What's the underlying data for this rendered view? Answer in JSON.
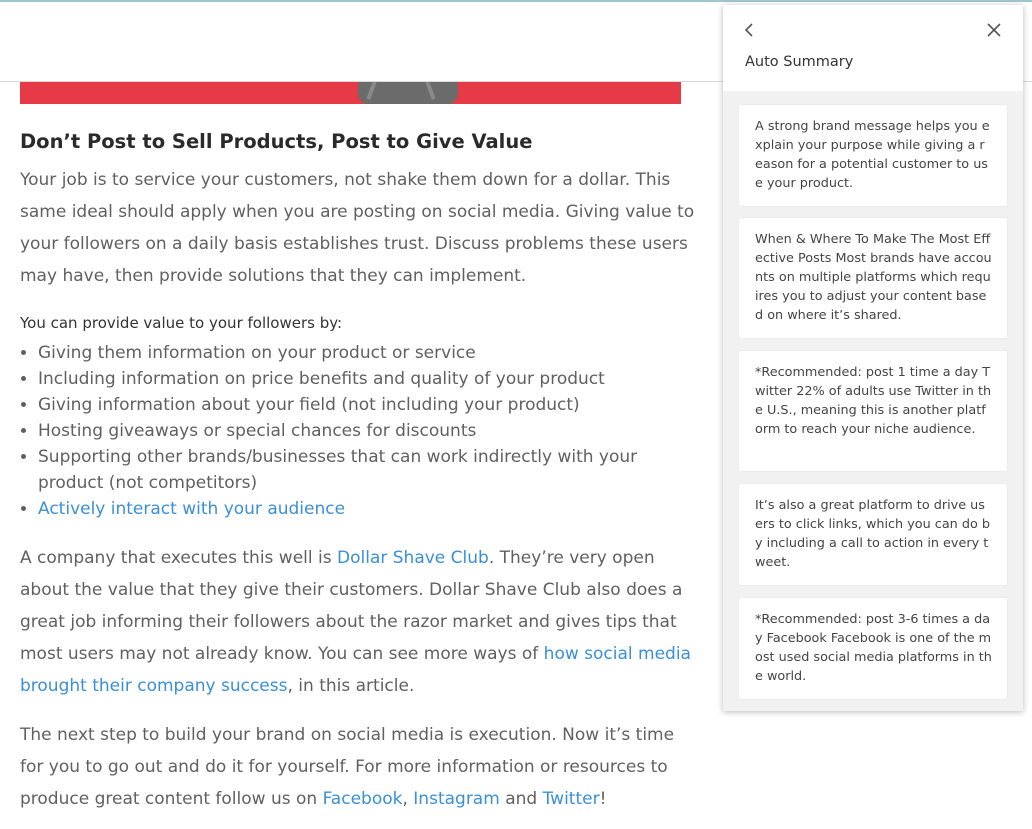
{
  "article": {
    "heading": "Don’t Post to Sell Products, Post to Give Value",
    "paragraph1": "Your job is to service your customers, not shake them down for a dollar. This same ideal should apply when you are posting on social media. Giving value to your followers on a daily basis establishes trust. Discuss problems these users may have, then provide solutions that they can implement.",
    "intro": "You can provide value to your followers by:",
    "bullets": [
      "Giving them information on your product or service",
      "Including information on price benefits and quality of your product",
      "Giving information about your field (not including your product)",
      "Hosting giveaways or special chances for discounts",
      "Supporting other brands/businesses that can work indirectly with your product (not competitors)"
    ],
    "bullet_link": "Actively interact with your audience",
    "paragraph2": {
      "before": "A company that executes this well is ",
      "link1": "Dollar Shave Club",
      "middle": ". They’re very open about the value that they give their customers. Dollar Shave Club also does a great job informing their followers about the razor market and gives tips that most users may not already know. You can see more ways of ",
      "link2": "how social media brought their company success",
      "after": ", in this article."
    },
    "paragraph3": {
      "before": "The next step to build your brand on social media is execution. Now it’s time for you to go out and do it for yourself. For more information or resources to produce great content follow us on ",
      "facebook": "Facebook",
      "comma": ", ",
      "instagram": "Instagram",
      "and": " and ",
      "twitter": "Twitter",
      "end": "!"
    }
  },
  "panel": {
    "title": "Auto Summary",
    "back_icon": "chevron-left-icon",
    "close_icon": "close-icon",
    "cards": [
      "A strong brand message helps you explain your purpose while giving a reason for a potential customer to use your product.",
      "When & Where To Make The Most Effective Posts Most brands have accounts on multiple platforms which requires you to adjust your content based on where it’s shared.",
      "*Recommended: post 1 time a day Twitter 22% of adults use Twitter in the U.S., meaning this is another platform to reach your niche audience.",
      "It’s also a great platform to drive users to click links, which you can do by including a call to action in every tweet.",
      "*Recommended: post 3-6 times a day Facebook Facebook is one of the most used social media platforms in the world."
    ]
  },
  "colors": {
    "link": "#3a8fd8",
    "hero": "#e63a46",
    "panel_bg": "#f1f1f1"
  }
}
